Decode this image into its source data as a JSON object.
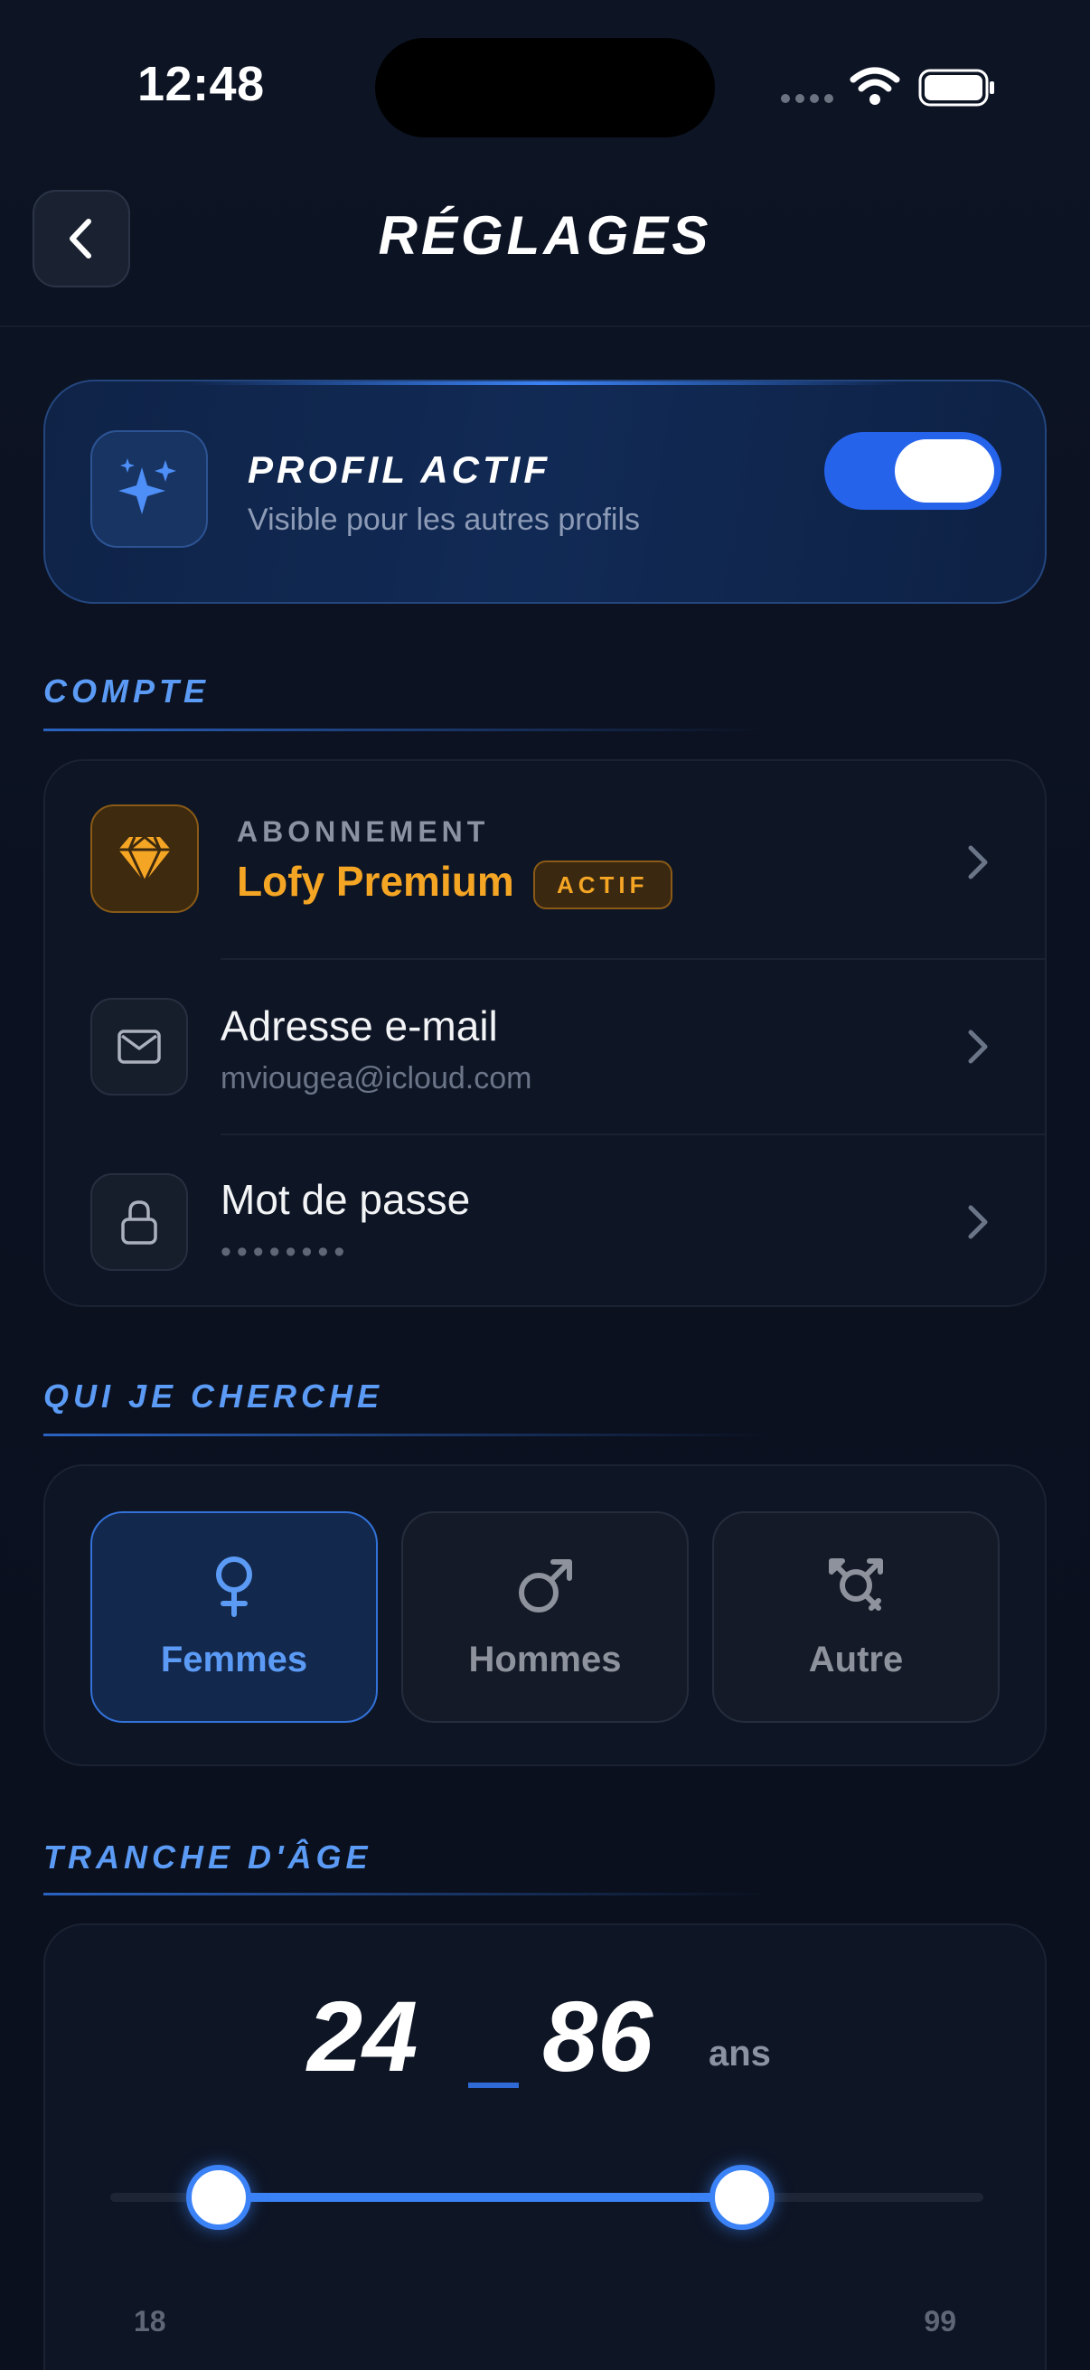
{
  "status_bar": {
    "time": "12:48"
  },
  "header": {
    "title": "RÉGLAGES"
  },
  "active_profile": {
    "title": "PROFIL ACTIF",
    "subtitle": "Visible pour les autres profils",
    "enabled": true
  },
  "account": {
    "section_title": "COMPTE",
    "subscription": {
      "label": "ABONNEMENT",
      "name": "Lofy Premium",
      "badge": "ACTIF"
    },
    "email": {
      "title": "Adresse e-mail",
      "value": "mviougea@icloud.com"
    },
    "password": {
      "title": "Mot de passe",
      "value": "••••••••"
    }
  },
  "looking_for": {
    "section_title": "QUI JE CHERCHE",
    "options": [
      {
        "label": "Femmes",
        "icon": "female-icon",
        "selected": true
      },
      {
        "label": "Hommes",
        "icon": "male-icon",
        "selected": false
      },
      {
        "label": "Autre",
        "icon": "transgender-icon",
        "selected": false
      }
    ]
  },
  "age_range": {
    "section_title": "TRANCHE D'ÂGE",
    "min": 24,
    "max": 86,
    "unit": "ans",
    "lower_bound": 18,
    "upper_bound": 99
  },
  "colors": {
    "accent": "#3b82f6",
    "section": "#5b9bf5",
    "premium": "#f5a524",
    "background": "#0b1120"
  }
}
